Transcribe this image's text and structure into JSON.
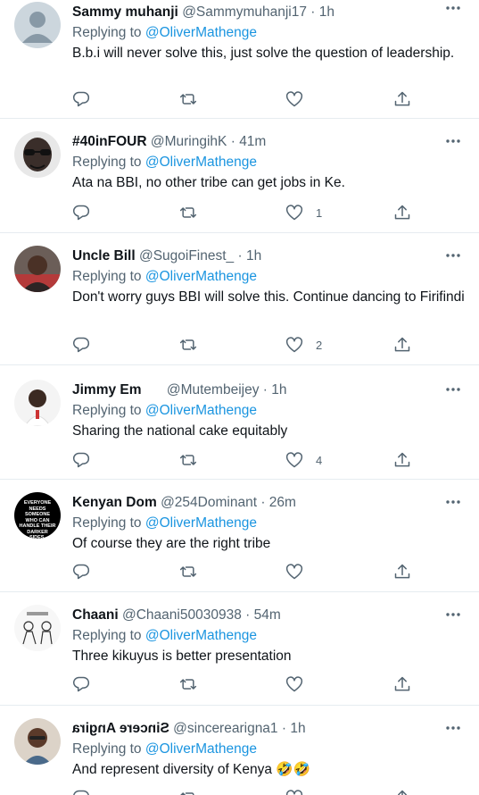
{
  "tweets": [
    {
      "name": "Sammy muhanji",
      "handle": "@Sammymuhanji17",
      "time": "1h",
      "replying_prefix": "Replying to ",
      "replying_to": "@OliverMathenge",
      "text": "B.b.i will never solve this, just solve the question of leadership.",
      "likes": ""
    },
    {
      "name": "#40inFOUR",
      "handle": "@MuringihK",
      "time": "41m",
      "replying_prefix": "Replying to ",
      "replying_to": "@OliverMathenge",
      "text": "Ata na BBI, no other tribe can get jobs in Ke.",
      "likes": "1"
    },
    {
      "name": "Uncle Bill",
      "handle": "@SugoiFinest_",
      "time": "1h",
      "replying_prefix": "Replying to ",
      "replying_to": "@OliverMathenge",
      "text": "Don't worry guys BBI will solve this. Continue dancing to Firifindi",
      "likes": "2"
    },
    {
      "name": "Jimmy Em",
      "handle": "@Mutembeijey",
      "time": "1h",
      "replying_prefix": "Replying to ",
      "replying_to": "@OliverMathenge",
      "text": "Sharing the national cake equitably",
      "likes": "4"
    },
    {
      "name": "Kenyan Dom",
      "handle": "@254Dominant",
      "time": "26m",
      "replying_prefix": "Replying to ",
      "replying_to": "@OliverMathenge",
      "text": "Of course they are the right tribe",
      "likes": "",
      "avatar_text": "EVERYONE NEEDS SOMEONE WHO CAN HANDLE THEIR DARKER SIDES."
    },
    {
      "name": "Chaani",
      "handle": "@Chaani50030938",
      "time": "54m",
      "replying_prefix": "Replying to ",
      "replying_to": "@OliverMathenge",
      "text": "Three kikuyus is better presentation",
      "likes": ""
    },
    {
      "name": "Sincere Angira",
      "handle": "@sincerearigna1",
      "time": "1h",
      "replying_prefix": "Replying to ",
      "replying_to": "@OliverMathenge",
      "text": "And represent diversity of Kenya",
      "likes": "",
      "emoji": "🤣🤣"
    }
  ],
  "icons": {
    "reply": "reply-icon",
    "retweet": "retweet-icon",
    "like": "heart-icon",
    "share": "share-icon",
    "more": "more-icon"
  },
  "colors": {
    "text": "#0f1419",
    "secondary": "#536471",
    "mention": "#1b95e0",
    "divider": "#e6ecf0"
  }
}
